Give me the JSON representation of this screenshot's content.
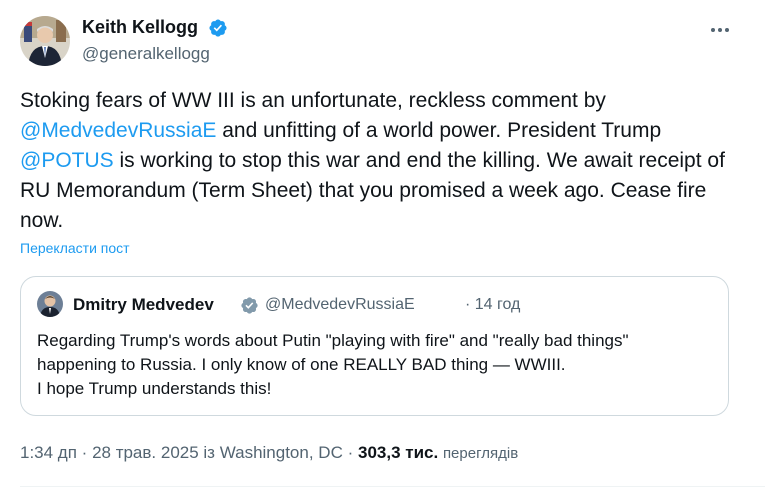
{
  "post": {
    "author": {
      "name": "Keith Kellogg",
      "handle": "@generalkellogg",
      "verified": true
    },
    "text_segments": [
      "Stoking fears of WW III is an unfortunate, reckless comment by ",
      "@MedvedevRussiaE",
      " and unfitting of a world power. President Trump ",
      "@POTUS",
      " is working to stop this war and end the killing. We await receipt of RU Memorandum (Term Sheet) that you promised a week ago. Cease fire now."
    ],
    "translate_label": "Перекласти пост",
    "more_icon": "more-horizontal-icon"
  },
  "quote": {
    "author": {
      "name": "Dmitry Medvedev",
      "handle": "@MedvedevRussiaE",
      "verified": true
    },
    "time": "· 14 год",
    "lines": [
      "Regarding Trump's words about Putin \"playing with fire\" and \"really bad things\"",
      "happening to Russia. I only know of one REALLY BAD thing — WWIII.",
      "I hope Trump understands this!"
    ]
  },
  "meta": {
    "time": "1:34 дп",
    "date": "28 трав. 2025 із Washington, DC",
    "views_count": "303,3 тис.",
    "views_label": "переглядів"
  },
  "colors": {
    "accent": "#1d9bf0",
    "secondary_text": "#536471",
    "border": "#cfd9de"
  }
}
